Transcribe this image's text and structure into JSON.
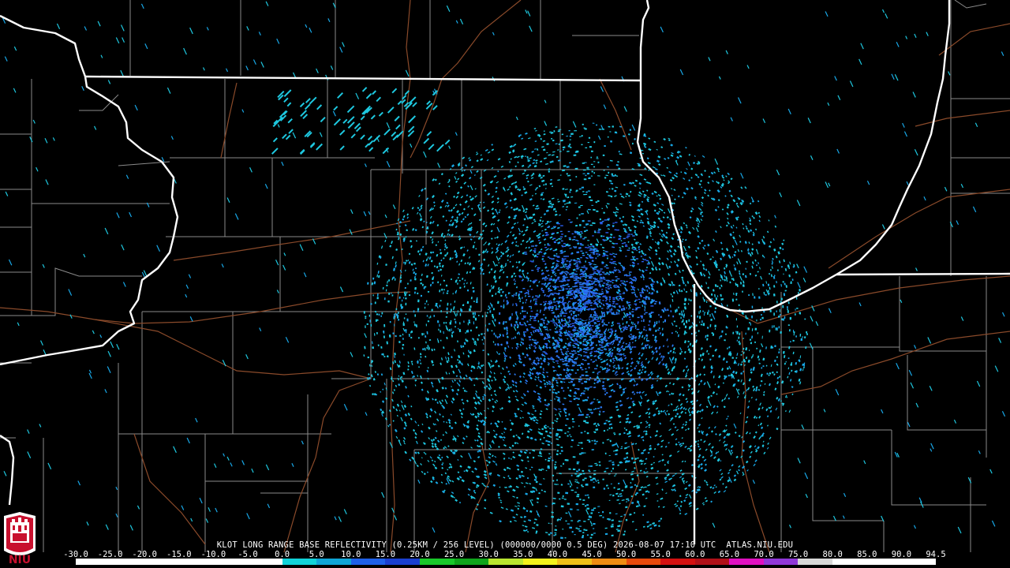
{
  "product": {
    "caption": "KLOT LONG RANGE BASE REFLECTIVITY (0.25KM / 256 LEVEL) (000000/0000 0.5 DEG) 2026-08-07 17:10 UTC  ATLAS.NIU.EDU"
  },
  "colorbar": {
    "ticks": [
      "-30.0",
      "-25.0",
      "-20.0",
      "-15.0",
      "-10.0",
      "-5.0",
      "0.0",
      "5.0",
      "10.0",
      "15.0",
      "20.0",
      "25.0",
      "30.0",
      "35.0",
      "40.0",
      "45.0",
      "50.0",
      "55.0",
      "60.0",
      "65.0",
      "70.0",
      "75.0",
      "80.0",
      "85.0",
      "90.0",
      "94.5"
    ],
    "colors": [
      "#ffffff",
      "#ffffff",
      "#ffffff",
      "#ffffff",
      "#ffffff",
      "#ffffff",
      "#11d2d8",
      "#0fa5d6",
      "#1e60e8",
      "#1a3fd0",
      "#19c82a",
      "#0fa41b",
      "#b8e630",
      "#f2f21c",
      "#f0c018",
      "#f08c12",
      "#e84a0c",
      "#d41010",
      "#b01018",
      "#e010c0",
      "#9038d8",
      "#d8d8d8",
      "#ffffff",
      "#ffffff",
      "#ffffff"
    ]
  },
  "logo": {
    "text": "NIU"
  },
  "map": {
    "state_color": "#ffffff",
    "county_color": "#8a8a8a",
    "road_color": "#8a4a2a",
    "echo_colors": [
      "#1ec8e0",
      "#18a8e8",
      "#2a78f0",
      "#12dcd4",
      "#2a5cf0"
    ]
  }
}
